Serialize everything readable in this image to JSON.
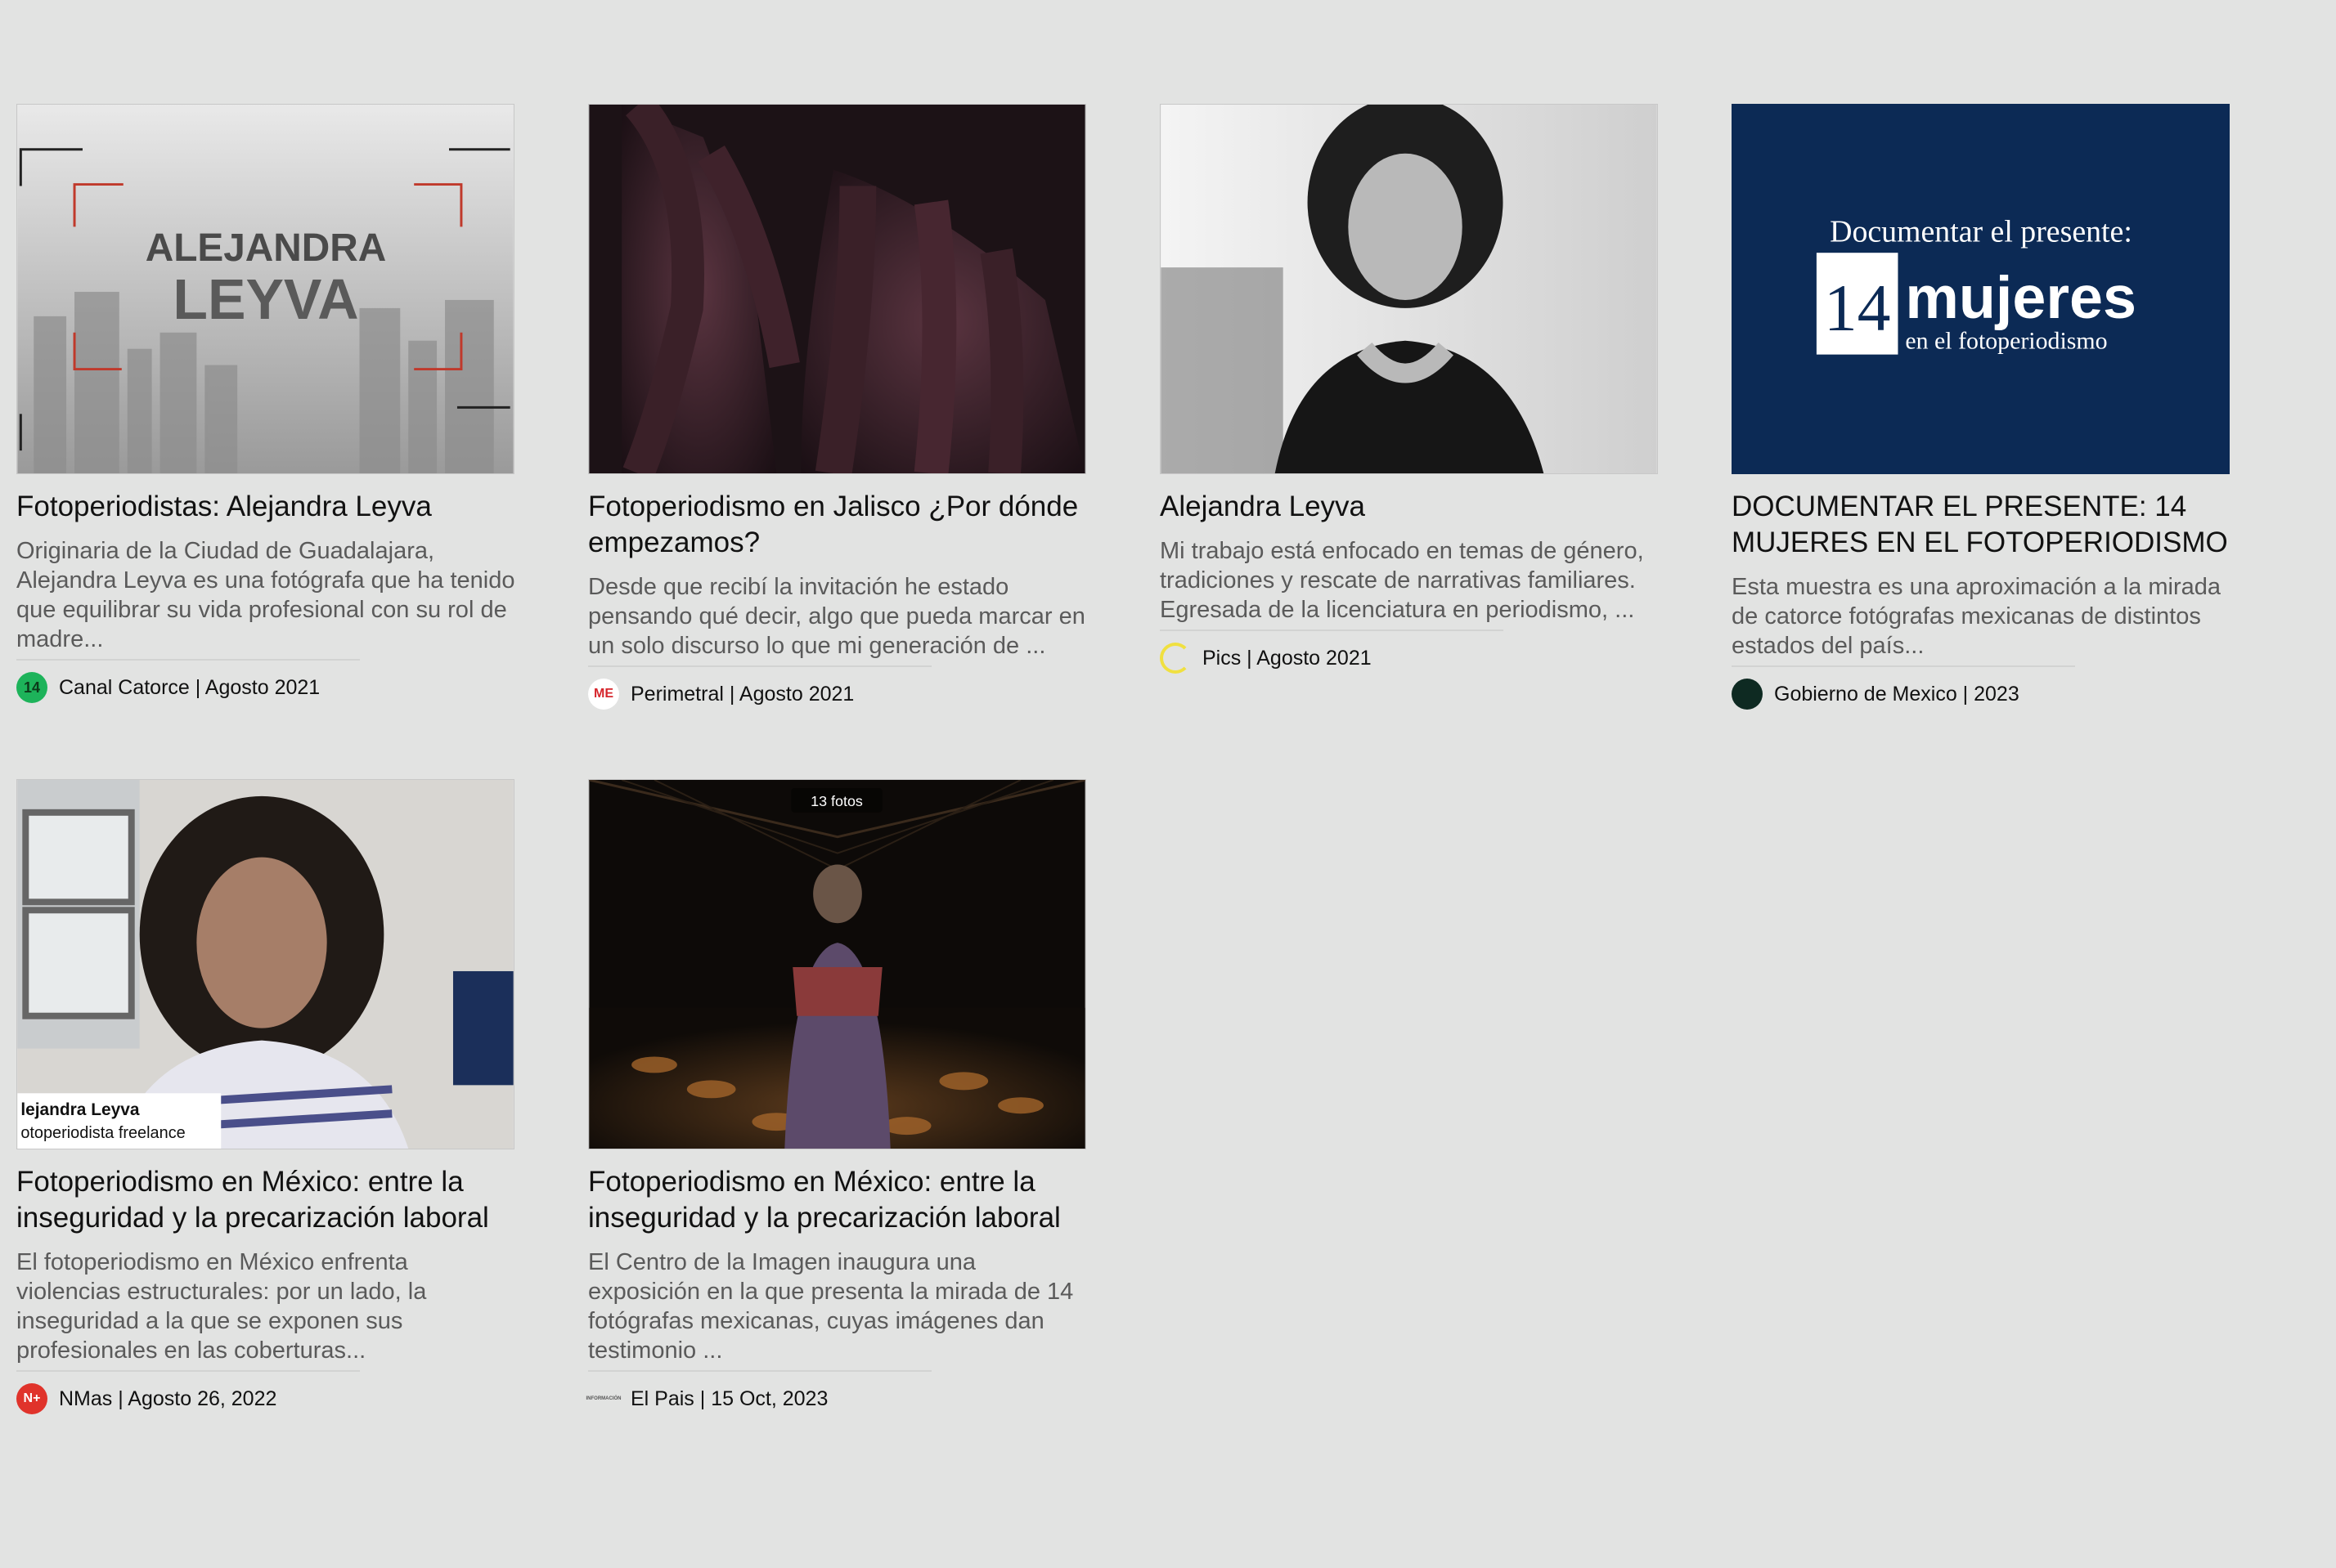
{
  "cards": [
    {
      "image_text_line1": "ALEJANDRA",
      "image_text_line2": "LEYVA",
      "title": "Fotoperiodistas: Alejandra Leyva",
      "desc": "Originaria de la Ciudad de Guadalajara, Alejandra Leyva es una fotógrafa que ha tenido que equilibrar su vida profesional con su rol de madre...",
      "source": "Canal Catorce | Agosto 2021",
      "logo_text": "14",
      "logo_color": "#1db35a"
    },
    {
      "title": "Fotoperiodismo en Jalisco ¿Por dónde empezamos?",
      "desc": "Desde que recibí la invitación he estado pensando qué decir, algo que pueda marcar en un solo discurso lo que mi generación de ...",
      "source": "Perimetral | Agosto 2021",
      "logo_text": "ME",
      "logo_color": "#d6262c"
    },
    {
      "title": "Alejandra Leyva",
      "desc": "Mi trabajo está enfocado en temas de género, tradiciones y rescate de narrativas familiares. Egresada de la licenciatura en periodismo, ...",
      "source": "Pics | Agosto 2021",
      "logo_text": "",
      "logo_color": "#f0e040"
    },
    {
      "image_text_line1": "Documentar el presente:",
      "image_text_number": "14",
      "image_text_word": "mujeres",
      "image_text_line3": "en el  fotoperiodismo",
      "title": "DOCUMENTAR EL PRESENTE: 14 MUJERES EN EL FOTOPERIODISMO",
      "desc": "Esta muestra es una aproximación a la mirada de catorce fotógrafas mexicanas de distintos estados del país...",
      "source": "Gobierno de Mexico | 2023",
      "logo_text": "",
      "logo_color": "#0e2a22"
    },
    {
      "image_caption_name": "lejandra Leyva",
      "image_caption_role": "otoperiodista freelance",
      "title": "Fotoperiodismo en México: entre la inseguridad y la precarización laboral",
      "desc": "El fotoperiodismo en México enfrenta violencias estructurales: por un lado, la inseguridad a la que se exponen sus profesionales en las coberturas...",
      "source": "NMas | Agosto 26, 2022",
      "logo_text": "N+",
      "logo_color": "#e0332b"
    },
    {
      "image_badge": "13 fotos",
      "title": "Fotoperiodismo en México: entre la inseguridad y la precarización laboral",
      "desc": "El Centro de la Imagen inaugura una exposición en la que presenta la mirada de 14 fotógrafas mexicanas, cuyas imágenes dan testimonio ...",
      "source": "El Pais | 15 Oct, 2023",
      "logo_text": "INFORMACIÓN",
      "logo_color": "#555555"
    }
  ]
}
